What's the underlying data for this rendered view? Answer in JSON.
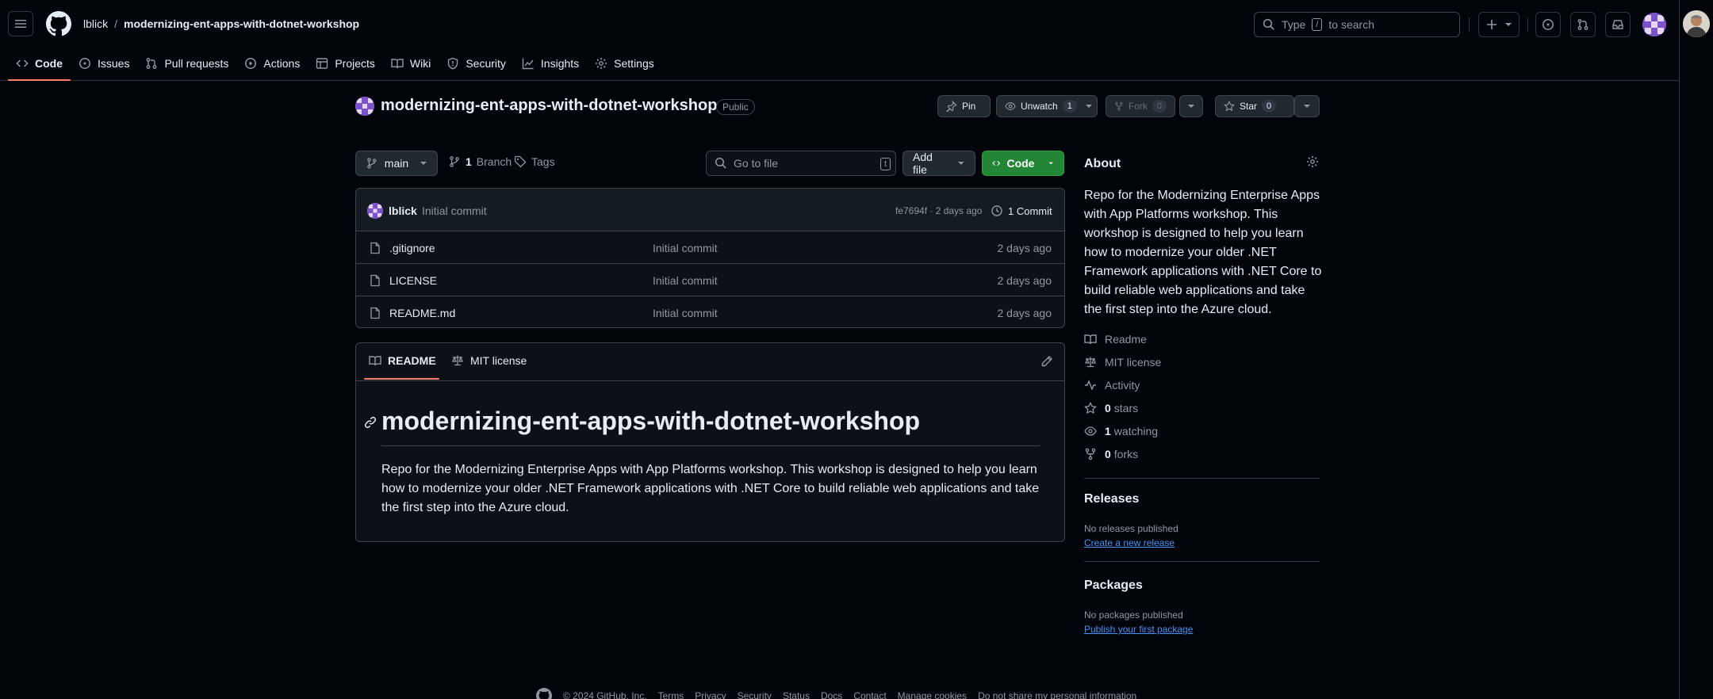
{
  "header": {
    "owner": "lblick",
    "separator": "/",
    "repo": "modernizing-ent-apps-with-dotnet-workshop",
    "search_prefix": "Type",
    "search_key": "/",
    "search_suffix": "to search"
  },
  "nav": {
    "tabs": [
      {
        "label": "Code",
        "icon": "code-icon"
      },
      {
        "label": "Issues",
        "icon": "issue-icon"
      },
      {
        "label": "Pull requests",
        "icon": "pull-request-icon"
      },
      {
        "label": "Actions",
        "icon": "play-icon"
      },
      {
        "label": "Projects",
        "icon": "table-icon"
      },
      {
        "label": "Wiki",
        "icon": "book-icon"
      },
      {
        "label": "Security",
        "icon": "shield-icon"
      },
      {
        "label": "Insights",
        "icon": "graph-icon"
      },
      {
        "label": "Settings",
        "icon": "gear-icon"
      }
    ]
  },
  "repo_header": {
    "title": "modernizing-ent-apps-with-dotnet-workshop",
    "visibility": "Public",
    "pin_label": "Pin",
    "unwatch_label": "Unwatch",
    "watch_count": "1",
    "fork_label": "Fork",
    "fork_count": "0",
    "star_label": "Star",
    "star_count": "0"
  },
  "controls": {
    "branch": "main",
    "branch_count": "1",
    "branch_label": "Branch",
    "tags_label": "Tags",
    "goto_placeholder": "Go to file",
    "goto_key": "t",
    "add_file_label": "Add file",
    "code_label": "Code"
  },
  "latest_commit": {
    "author": "lblick",
    "message": "Initial commit",
    "sha_time": "fe7694f · 2 days ago",
    "commits": "1 Commit"
  },
  "files": [
    {
      "name": ".gitignore",
      "message": "Initial commit",
      "date": "2 days ago"
    },
    {
      "name": "LICENSE",
      "message": "Initial commit",
      "date": "2 days ago"
    },
    {
      "name": "README.md",
      "message": "Initial commit",
      "date": "2 days ago"
    }
  ],
  "readme": {
    "tab_readme": "README",
    "tab_license": "MIT license",
    "heading": "modernizing-ent-apps-with-dotnet-workshop",
    "body": "Repo for the Modernizing Enterprise Apps with App Platforms workshop. This workshop is designed to help you learn how to modernize your older .NET Framework applications with .NET Core to build reliable web applications and take the first step into the Azure cloud."
  },
  "about": {
    "title": "About",
    "description": "Repo for the Modernizing Enterprise Apps with App Platforms workshop. This workshop is designed to help you learn how to modernize your older .NET Framework applications with .NET Core to build reliable web applications and take the first step into the Azure cloud.",
    "readme": "Readme",
    "license": "MIT license",
    "activity": "Activity",
    "stars_count": "0",
    "stars_label": "stars",
    "watching_count": "1",
    "watching_label": "watching",
    "forks_count": "0",
    "forks_label": "forks"
  },
  "releases": {
    "title": "Releases",
    "none": "No releases published",
    "create": "Create a new release"
  },
  "packages": {
    "title": "Packages",
    "none": "No packages published",
    "publish": "Publish your first package"
  },
  "footer": {
    "copyright": "© 2024 GitHub, Inc.",
    "links": [
      "Terms",
      "Privacy",
      "Security",
      "Status",
      "Docs",
      "Contact",
      "Manage cookies",
      "Do not share my personal information"
    ]
  },
  "colors": {
    "bg": "#010409",
    "accent_underline": "#f78166",
    "code_button": "#238636",
    "link": "#4493f8"
  }
}
